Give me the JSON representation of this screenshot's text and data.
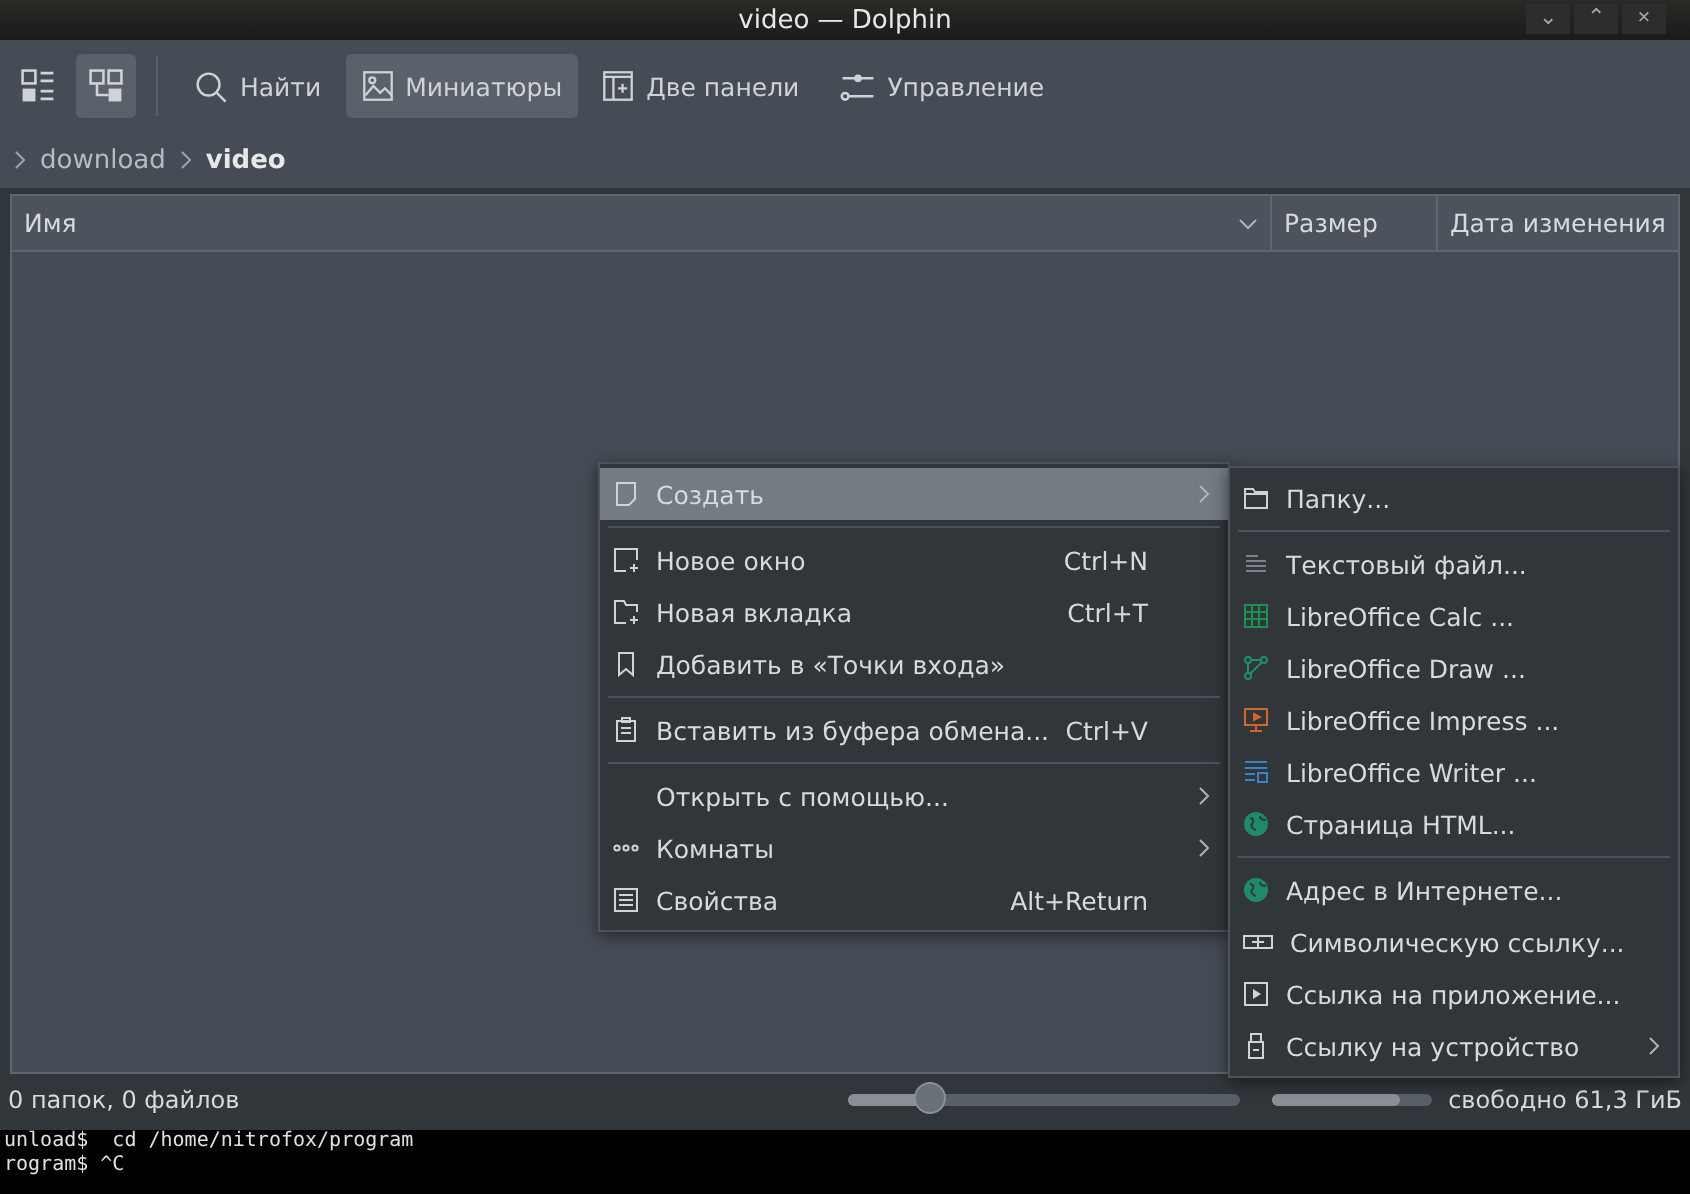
{
  "window": {
    "title": "video — Dolphin",
    "controls": [
      "⌄",
      "⌃",
      "×"
    ]
  },
  "toolbar": [
    {
      "kind": "view",
      "selected": false
    },
    {
      "kind": "view",
      "selected": true
    },
    {
      "kind": "action",
      "label": "Найти",
      "selected": false
    },
    {
      "kind": "action",
      "label": "Миниатюры",
      "selected": true
    },
    {
      "kind": "action",
      "label": "Две панели",
      "selected": false
    },
    {
      "kind": "action",
      "label": "Управление",
      "selected": false
    }
  ],
  "breadcrumb": [
    {
      "label": "download",
      "current": false
    },
    {
      "label": "video",
      "current": true
    }
  ],
  "table": {
    "columns": [
      "Имя",
      "Размер",
      "Дата изменения"
    ]
  },
  "context_menu": {
    "groups": [
      [
        {
          "label": "Создать",
          "submenu": true,
          "selected": true
        }
      ],
      [
        {
          "label": "Новое окно",
          "shortcut": "Ctrl+N",
          "submenu": false,
          "selected": false
        },
        {
          "label": "Новая вкладка",
          "shortcut": "Ctrl+T",
          "submenu": false,
          "selected": false
        },
        {
          "label": "Добавить в «Точки входа»",
          "submenu": false,
          "selected": false
        }
      ],
      [
        {
          "label": "Вставить из буфера обмена...",
          "shortcut": "Ctrl+V",
          "submenu": false,
          "selected": false
        }
      ],
      [
        {
          "label": "Открыть с помощью...",
          "submenu": true,
          "selected": false
        },
        {
          "label": "Комнаты",
          "submenu": true,
          "selected": false
        },
        {
          "label": "Свойства",
          "shortcut": "Alt+Return",
          "submenu": false,
          "selected": false
        }
      ]
    ]
  },
  "submenu": {
    "groups": [
      [
        {
          "label": "Папку...",
          "submenu": false
        }
      ],
      [
        {
          "label": "Текстовый файл...",
          "submenu": false
        },
        {
          "label": "LibreOffice Calc  ...",
          "submenu": false
        },
        {
          "label": "LibreOffice Draw  ...",
          "submenu": false
        },
        {
          "label": "LibreOffice Impress  ...",
          "submenu": false
        },
        {
          "label": "LibreOffice Writer  ...",
          "submenu": false
        },
        {
          "label": "Страница HTML...",
          "submenu": false
        }
      ],
      [
        {
          "label": "Адрес в Интернете...",
          "submenu": false
        },
        {
          "label": "Символическую ссылку...",
          "submenu": false
        },
        {
          "label": "Ссылка на приложение...",
          "submenu": false
        },
        {
          "label": "Ссылку на устройство",
          "submenu": true
        }
      ]
    ]
  },
  "status_bar": {
    "text": "0 папок, 0 файлов",
    "zoom": {
      "level": 0.21
    },
    "disk": {
      "level": 0.8
    },
    "free": "свободно 61,3 ГиБ"
  },
  "terminal": {
    "lines": [
      "unload$  cd /home/nitrofox/program",
      "rogram$ ^C"
    ]
  }
}
